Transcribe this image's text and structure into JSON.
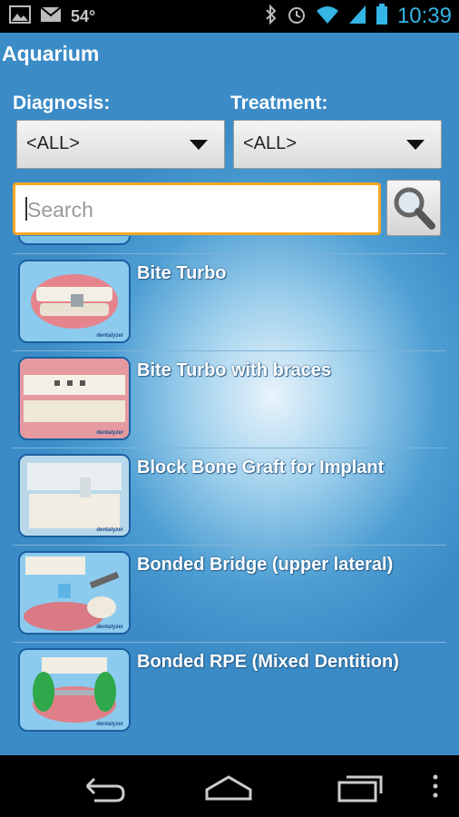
{
  "status_bar": {
    "temperature": "54°",
    "time": "10:39",
    "icons": [
      "picture-icon",
      "gmail-icon",
      "bluetooth-icon",
      "alarm-icon",
      "wifi-icon",
      "signal-icon",
      "battery-icon"
    ]
  },
  "app": {
    "title": "Aquarium"
  },
  "filters": {
    "diagnosis_label": "Diagnosis:",
    "diagnosis_value": "<ALL>",
    "treatment_label": "Treatment:",
    "treatment_value": "<ALL>"
  },
  "search": {
    "placeholder": "Search",
    "button_icon": "magnifier-icon"
  },
  "items": [
    {
      "title": "Bite Turbo"
    },
    {
      "title": "Bite Turbo with braces"
    },
    {
      "title": "Block Bone Graft for Implant"
    },
    {
      "title": "Bonded Bridge (upper lateral)"
    },
    {
      "title": "Bonded RPE (Mixed Dentition)"
    }
  ],
  "nav": {
    "icons": [
      "back-icon",
      "home-icon",
      "recent-apps-icon",
      "overflow-menu-icon"
    ]
  },
  "colors": {
    "accent": "#33b5e5",
    "search_border": "#f5a623",
    "background": "#3b8bc6"
  }
}
